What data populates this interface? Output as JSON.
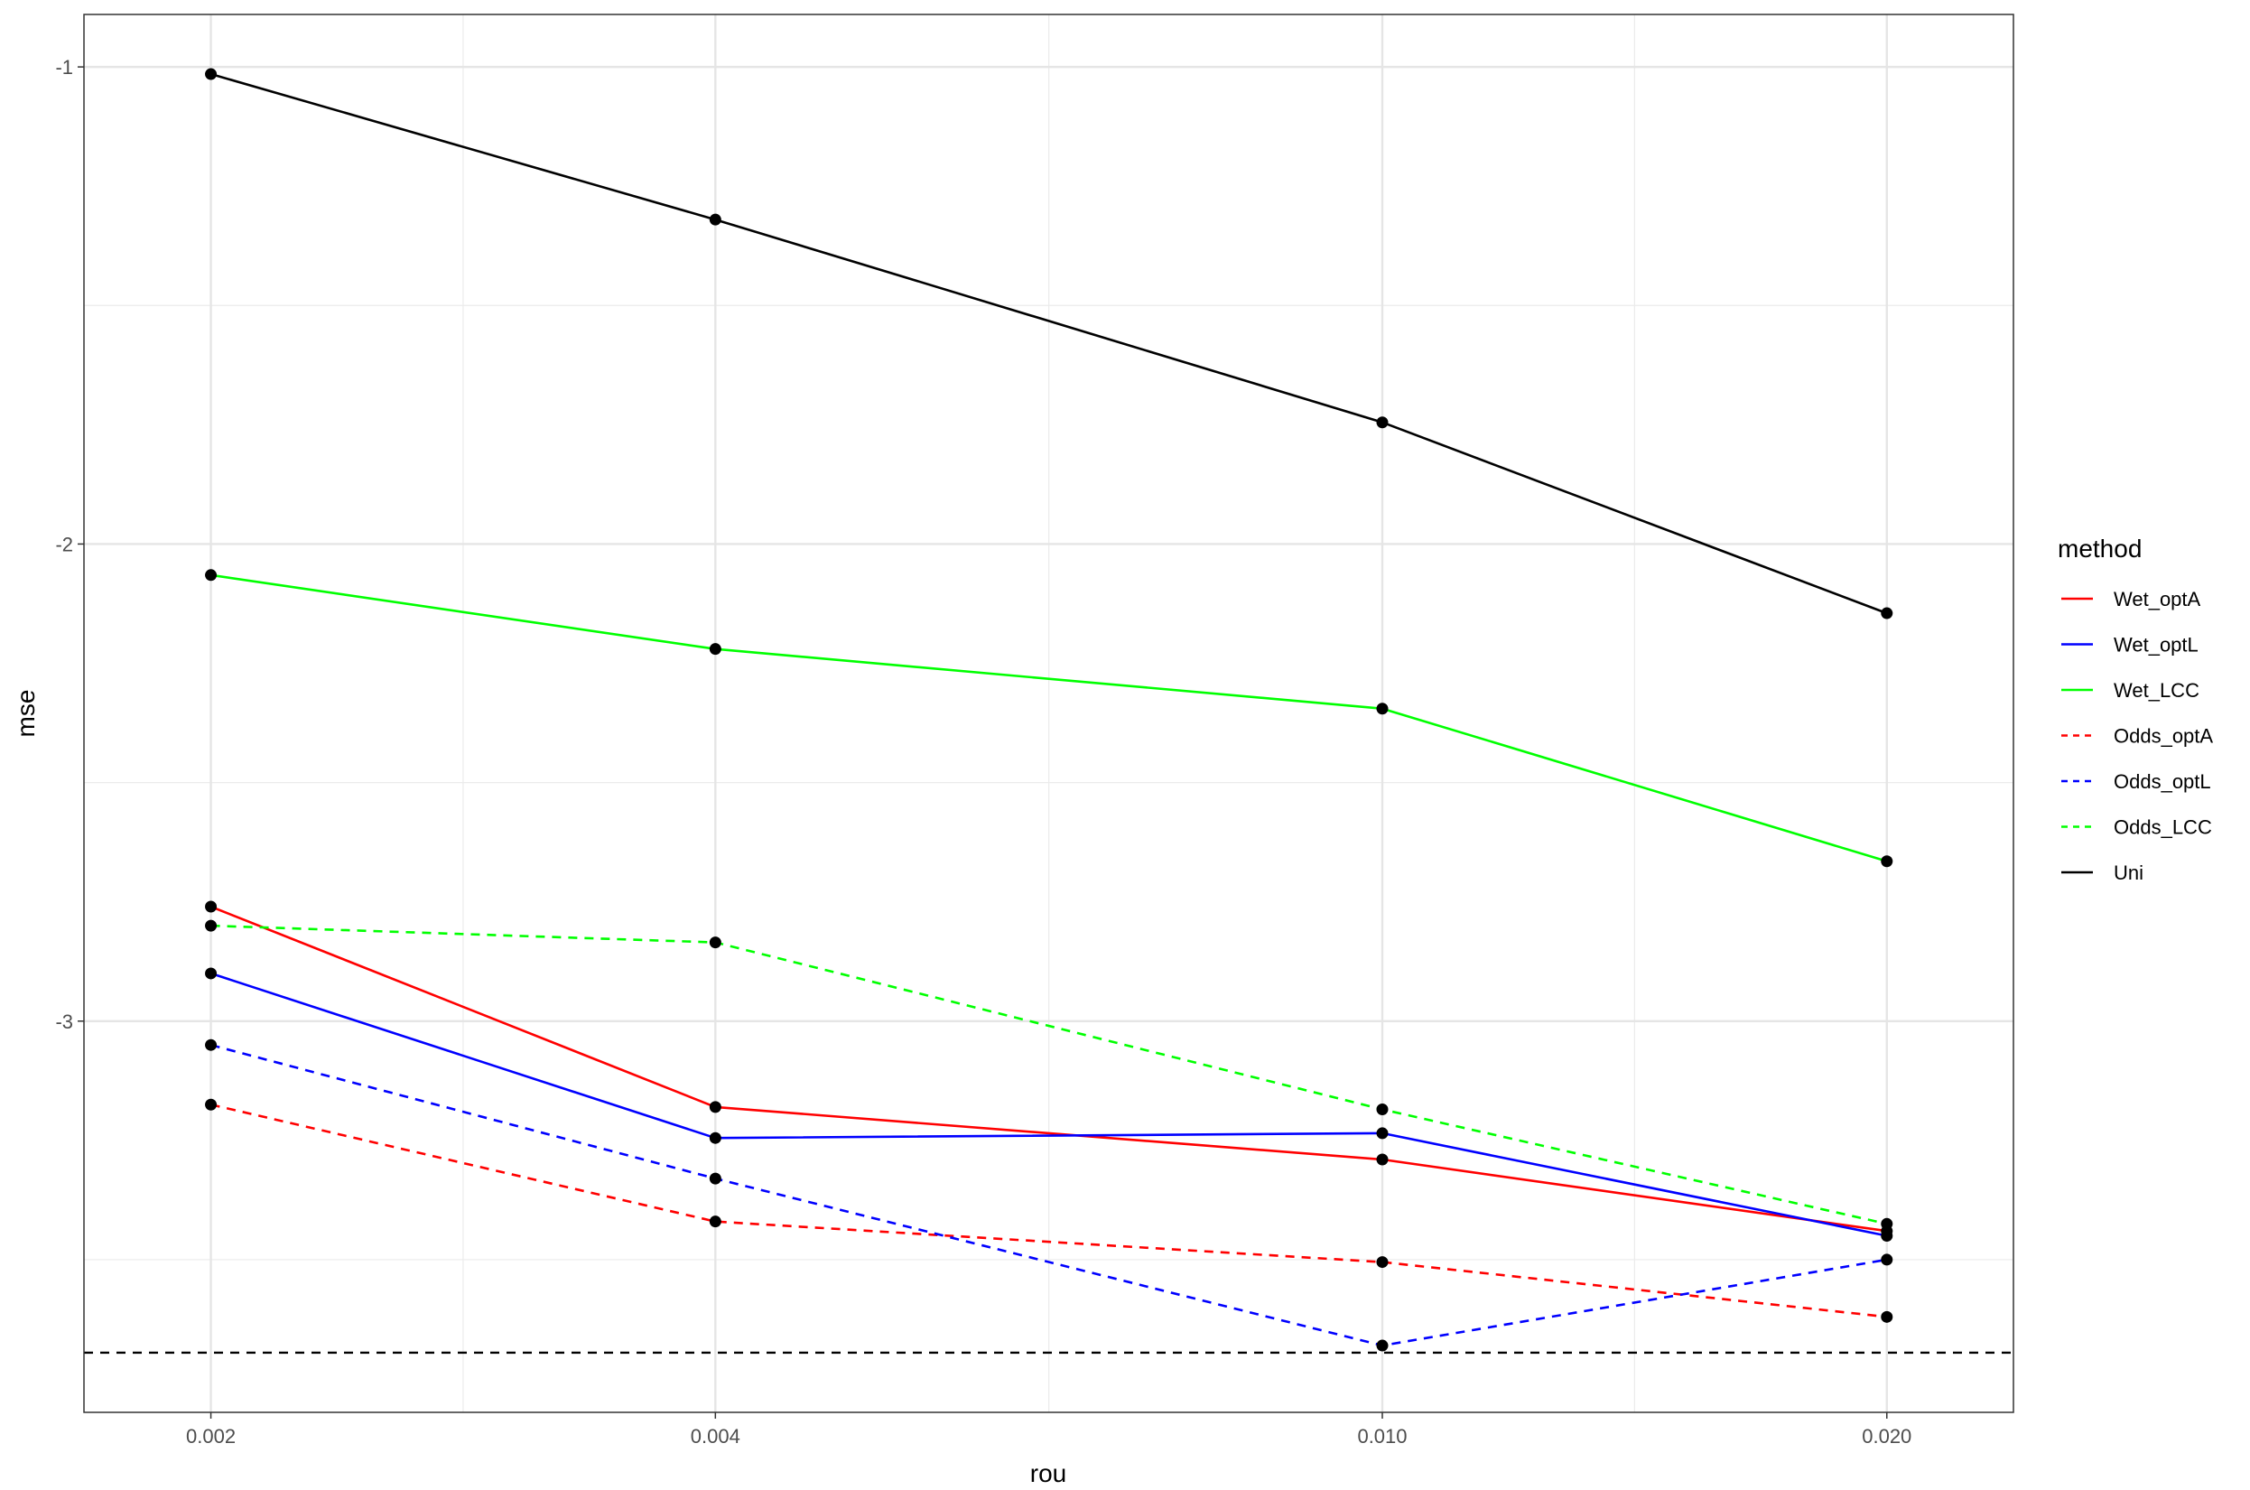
{
  "chart_data": {
    "type": "line",
    "title": "",
    "xlabel": "rou",
    "ylabel": "mse",
    "x": [
      0.002,
      0.004,
      0.01,
      0.02
    ],
    "x_tick_labels": [
      "0.002",
      "0.004",
      "0.010",
      "0.020"
    ],
    "x_scale": "log",
    "xlim": [
      0.00168,
      0.0238
    ],
    "y_ticks": [
      -1,
      -2,
      -3
    ],
    "y_tick_labels": [
      "-1",
      "-2",
      "-3"
    ],
    "ylim": [
      -3.82,
      -0.89
    ],
    "grid": true,
    "legend_title": "method",
    "legend_position": "right",
    "series": [
      {
        "name": "Wet_optA",
        "color": "#ff0000",
        "linetype": "solid",
        "values": [
          -2.76,
          -3.18,
          -3.29,
          -3.44
        ]
      },
      {
        "name": "Wet_optL",
        "color": "#0000ff",
        "linetype": "solid",
        "values": [
          -2.9,
          -3.245,
          -3.235,
          -3.45
        ]
      },
      {
        "name": "Wet_LCC",
        "color": "#00ff00",
        "linetype": "solid",
        "values": [
          -2.065,
          -2.22,
          -2.345,
          -2.665
        ]
      },
      {
        "name": "Odds_optA",
        "color": "#ff0000",
        "linetype": "dashed",
        "values": [
          -3.175,
          -3.42,
          -3.505,
          -3.62
        ]
      },
      {
        "name": "Odds_optL",
        "color": "#0000ff",
        "linetype": "dashed",
        "values": [
          -3.05,
          -3.33,
          -3.68,
          -3.5
        ]
      },
      {
        "name": "Odds_LCC",
        "color": "#00ff00",
        "linetype": "dashed",
        "values": [
          -2.8,
          -2.835,
          -3.185,
          -3.425
        ]
      },
      {
        "name": "Uni",
        "color": "#000000",
        "linetype": "solid",
        "values": [
          -1.015,
          -1.32,
          -1.745,
          -2.145
        ]
      }
    ],
    "reference_lines": [
      {
        "type": "horizontal",
        "y": -3.695,
        "color": "#000000",
        "linetype": "dashed"
      }
    ]
  }
}
